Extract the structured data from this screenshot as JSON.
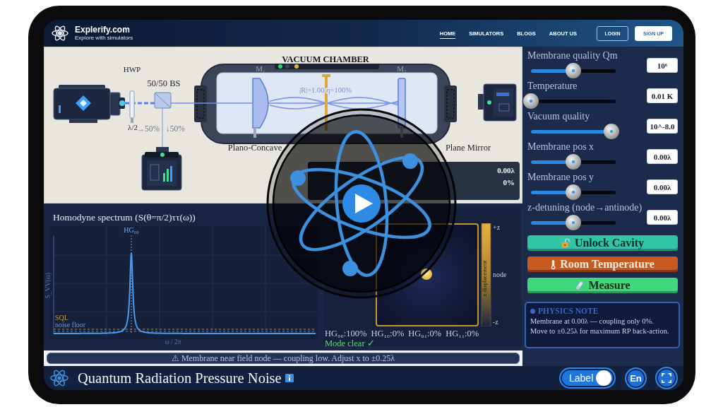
{
  "header": {
    "site_name": "Explerify.com",
    "tagline": "Explore with simulators",
    "nav": [
      {
        "label": "HOME",
        "selected": true
      },
      {
        "label": "SIMULATORS",
        "selected": false
      },
      {
        "label": "BLOGS",
        "selected": false
      },
      {
        "label": "ABOUT US",
        "selected": false
      }
    ],
    "buttons": [
      {
        "label": "LOGIN",
        "kind": "outline"
      },
      {
        "label": "SIGN UP",
        "kind": "solid"
      }
    ]
  },
  "setup": {
    "chamber_label": "VACUUM CHAMBER",
    "chamber_lights": [
      {
        "color": "#2fd06a"
      },
      {
        "color": "#3a4252"
      },
      {
        "color": "#e8b83a"
      }
    ],
    "waveplate_label": "HWP",
    "waveplate_type": "λ/2",
    "splitter_label": "50/50 BS",
    "split_ratios": [
      "→50%",
      "↓50%"
    ],
    "mirrors": [
      {
        "tag": "M₁",
        "label": "Plano-Concave",
        "kind": "concave"
      },
      {
        "tag": "M₂",
        "label": "Plane Mirror",
        "kind": "flat"
      }
    ],
    "cavity_readout": "|R|=1.00 η=100%",
    "status_values": [
      "0.00λ",
      "0%"
    ]
  },
  "spectrum": {
    "title": "Homodyne spectrum (S(θ=π/2)ττ(ω))",
    "peak_label": "HG₀₀",
    "y_label": "S_VV(ω)",
    "x_label": "ω / 2π",
    "sql_label": "SQL",
    "floor_label": "noise floor"
  },
  "mode_map": {
    "scale_labels": [
      "+z",
      "node",
      "-z"
    ],
    "scale_title": "z displacement",
    "weights": [
      "HG₀₀:100%",
      "HG₁₀:0%",
      "HG₀₁:0%",
      "HG₁₁:0%"
    ],
    "status": "Mode clear ✓"
  },
  "warning": "⚠ Membrane near field node — coupling low. Adjust x to ±0.25λ",
  "controls": [
    {
      "label": "Membrane quality Qm",
      "level": 0.5,
      "value": "10⁶"
    },
    {
      "label": "Temperature",
      "level": 0,
      "value": "0.01 K"
    },
    {
      "label": "Vacuum quality",
      "level": 0.95,
      "value": "10^-8.0"
    },
    {
      "label": "Membrane pos x",
      "level": 0.5,
      "value": "0.00λ"
    },
    {
      "label": "Membrane pos y",
      "level": 0.5,
      "value": "0.00λ"
    },
    {
      "label": "z-detuning (node→antinode)",
      "level": 0.5,
      "value": "0.00λ"
    }
  ],
  "actions": [
    {
      "label": "Unlock Cavity",
      "kind": "unlock"
    },
    {
      "label": "Room Temperature",
      "kind": "heat"
    },
    {
      "label": "Measure",
      "kind": "measure"
    }
  ],
  "physics_note": {
    "title": "PHYSICS NOTE",
    "lines": [
      "Membrane at 0.00λ — coupling only 0%.",
      "Move to ±0.25λ for maximum RP back-action."
    ]
  },
  "footer": {
    "title": "Quantum Radiation Pressure Noise",
    "label_toggle": {
      "label": "Label",
      "on": true
    },
    "language": "En"
  }
}
